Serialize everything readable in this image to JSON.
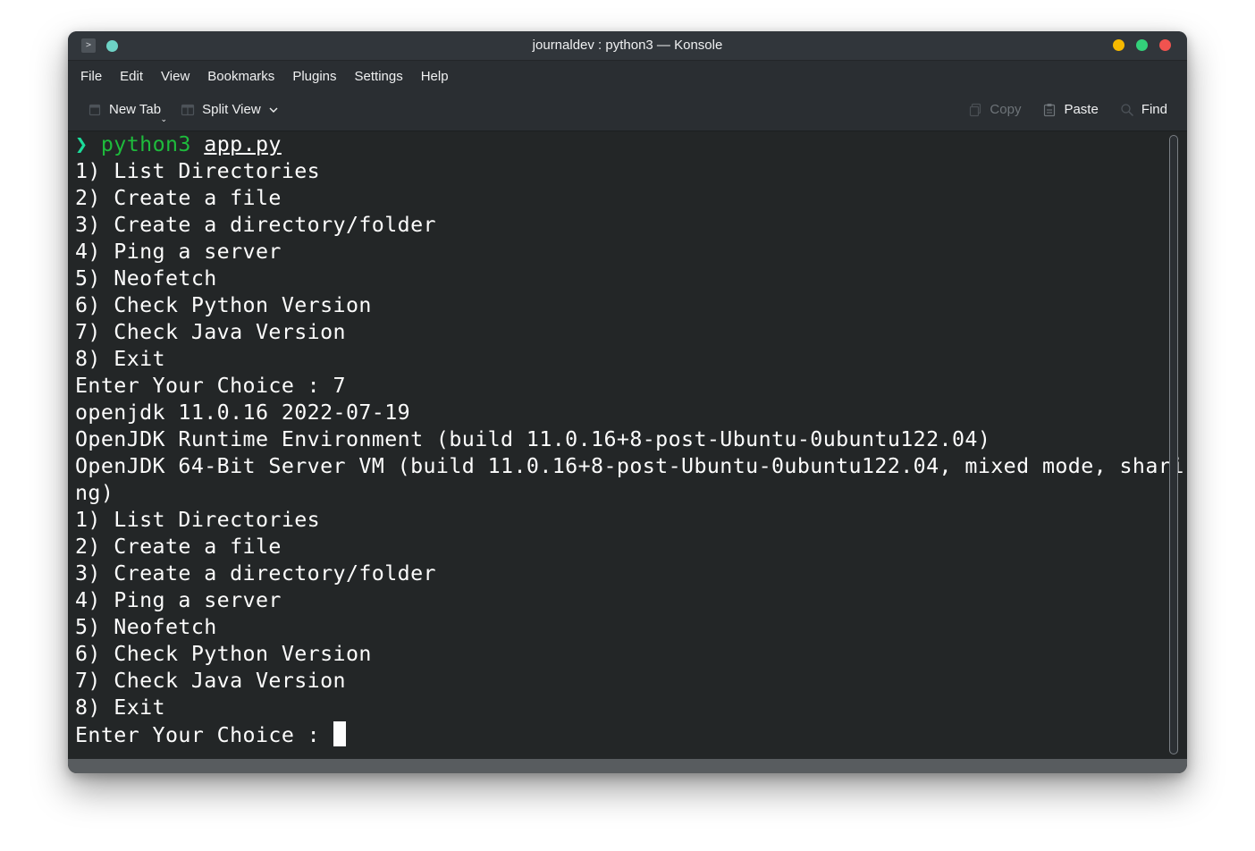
{
  "window": {
    "title": "journaldev : python3 — Konsole"
  },
  "menu": [
    "File",
    "Edit",
    "View",
    "Bookmarks",
    "Plugins",
    "Settings",
    "Help"
  ],
  "toolbar": {
    "new_tab": "New Tab",
    "split_view": "Split View",
    "copy": "Copy",
    "paste": "Paste",
    "find": "Find"
  },
  "terminal": {
    "prompt_symbol": "❯",
    "command": "python3",
    "argument": "app.py",
    "lines": [
      "1) List Directories",
      "2) Create a file",
      "3) Create a directory/folder",
      "4) Ping a server",
      "5) Neofetch",
      "6) Check Python Version",
      "7) Check Java Version",
      "8) Exit",
      "Enter Your Choice : 7",
      "openjdk 11.0.16 2022-07-19",
      "OpenJDK Runtime Environment (build 11.0.16+8-post-Ubuntu-0ubuntu122.04)",
      "OpenJDK 64-Bit Server VM (build 11.0.16+8-post-Ubuntu-0ubuntu122.04, mixed mode, shari",
      "ng)",
      "1) List Directories",
      "2) Create a file",
      "3) Create a directory/folder",
      "4) Ping a server",
      "5) Neofetch",
      "6) Check Python Version",
      "7) Check Java Version",
      "8) Exit"
    ],
    "last_prompt": "Enter Your Choice : "
  },
  "colors": {
    "close": "#f0534f",
    "maximize": "#33d17a",
    "minimize": "#f6b900",
    "prompt_symbol": "#1cdc9a",
    "command": "#1ebb3c"
  },
  "icons": {
    "app": "terminal-app-icon",
    "pin": "keep-above-icon",
    "new_tab": "new-tab-icon",
    "split_view": "split-view-icon",
    "copy": "copy-icon",
    "paste": "paste-icon",
    "find": "find-icon"
  }
}
